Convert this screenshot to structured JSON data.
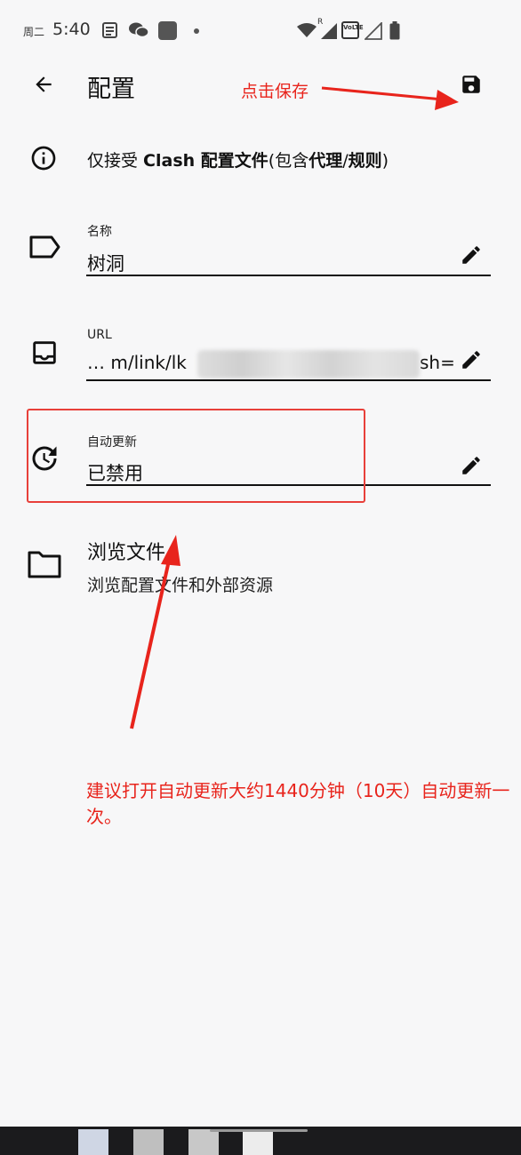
{
  "status_bar": {
    "day": "周二",
    "time": "5:40",
    "roaming": "R",
    "volte": "VoLTE",
    "icons": [
      "notes-icon",
      "wechat-icon",
      "app-square-icon",
      "dot-icon",
      "wifi-icon",
      "signal-icon",
      "volte-icon",
      "signal-icon",
      "battery-icon"
    ]
  },
  "toolbar": {
    "title": "配置",
    "back_icon": "arrow-back-icon",
    "save_icon": "floppy-save-icon"
  },
  "info": {
    "text_prefix": "仅接受 ",
    "text_bold1": "Clash 配置文件",
    "text_mid": "(包含",
    "text_bold2": "代理",
    "text_slash": "/",
    "text_bold3": "规则",
    "text_suffix": ")"
  },
  "fields": {
    "name": {
      "label": "名称",
      "value": "树洞"
    },
    "url": {
      "label": "URL",
      "value_start": "… m/link/lk",
      "value_end": "sh="
    },
    "auto_update": {
      "label": "自动更新",
      "value": "已禁用"
    }
  },
  "browse": {
    "title": "浏览文件",
    "subtitle": "浏览配置文件和外部资源"
  },
  "annotations": {
    "save_hint": "点击保存",
    "tip": "建议打开自动更新大约1440分钟（10天）自动更新一次。",
    "color": "#e8241c"
  }
}
